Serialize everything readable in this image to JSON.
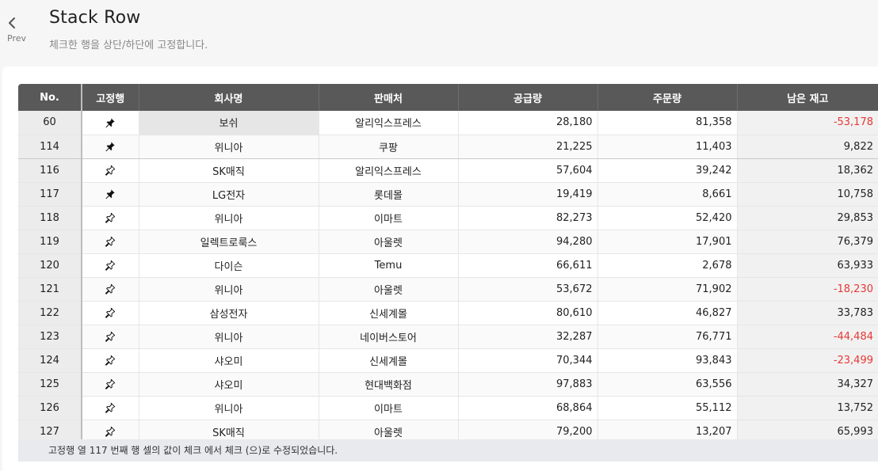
{
  "header": {
    "back_label": "Prev",
    "title": "Stack Row",
    "subtitle": "체크한 행을 상단/하단에 고정합니다."
  },
  "grid": {
    "columns": [
      "No.",
      "고정행",
      "회사명",
      "판매처",
      "공급량",
      "주문량",
      "남은 재고"
    ],
    "rows": [
      {
        "no": "60",
        "pinned": true,
        "company": "보쉬",
        "seller": "알리익스프레스",
        "supply": "28,180",
        "order": "81,358",
        "stock": "-53,178",
        "negative": true
      },
      {
        "no": "114",
        "pinned": true,
        "company": "위니아",
        "seller": "쿠팡",
        "supply": "21,225",
        "order": "11,403",
        "stock": "9,822",
        "negative": false
      },
      {
        "no": "116",
        "pinned": false,
        "company": "SK매직",
        "seller": "알리익스프레스",
        "supply": "57,604",
        "order": "39,242",
        "stock": "18,362",
        "negative": false
      },
      {
        "no": "117",
        "pinned": true,
        "company": "LG전자",
        "seller": "롯데몰",
        "supply": "19,419",
        "order": "8,661",
        "stock": "10,758",
        "negative": false
      },
      {
        "no": "118",
        "pinned": false,
        "company": "위니아",
        "seller": "이마트",
        "supply": "82,273",
        "order": "52,420",
        "stock": "29,853",
        "negative": false
      },
      {
        "no": "119",
        "pinned": false,
        "company": "일렉트로룩스",
        "seller": "아울렛",
        "supply": "94,280",
        "order": "17,901",
        "stock": "76,379",
        "negative": false
      },
      {
        "no": "120",
        "pinned": false,
        "company": "다이슨",
        "seller": "Temu",
        "supply": "66,611",
        "order": "2,678",
        "stock": "63,933",
        "negative": false
      },
      {
        "no": "121",
        "pinned": false,
        "company": "위니아",
        "seller": "아울렛",
        "supply": "53,672",
        "order": "71,902",
        "stock": "-18,230",
        "negative": true
      },
      {
        "no": "122",
        "pinned": false,
        "company": "삼성전자",
        "seller": "신세계몰",
        "supply": "80,610",
        "order": "46,827",
        "stock": "33,783",
        "negative": false
      },
      {
        "no": "123",
        "pinned": false,
        "company": "위니아",
        "seller": "네이버스토어",
        "supply": "32,287",
        "order": "76,771",
        "stock": "-44,484",
        "negative": true
      },
      {
        "no": "124",
        "pinned": false,
        "company": "샤오미",
        "seller": "신세계몰",
        "supply": "70,344",
        "order": "93,843",
        "stock": "-23,499",
        "negative": true
      },
      {
        "no": "125",
        "pinned": false,
        "company": "샤오미",
        "seller": "현대백화점",
        "supply": "97,883",
        "order": "63,556",
        "stock": "34,327",
        "negative": false
      },
      {
        "no": "126",
        "pinned": false,
        "company": "위니아",
        "seller": "이마트",
        "supply": "68,864",
        "order": "55,112",
        "stock": "13,752",
        "negative": false
      },
      {
        "no": "127",
        "pinned": false,
        "company": "SK매직",
        "seller": "아울렛",
        "supply": "79,200",
        "order": "13,207",
        "stock": "65,993",
        "negative": false
      }
    ],
    "negative_color": "#e53935",
    "header_color": "#595959"
  },
  "status": {
    "message": "고정행 열 117 번째 행 셀의 값이 체크 에서 체크 (으)로 수정되었습니다."
  },
  "icons": {
    "back": "chevron-left-icon",
    "pin_filled": "pin-filled-icon",
    "pin_outline": "pin-outline-icon"
  }
}
